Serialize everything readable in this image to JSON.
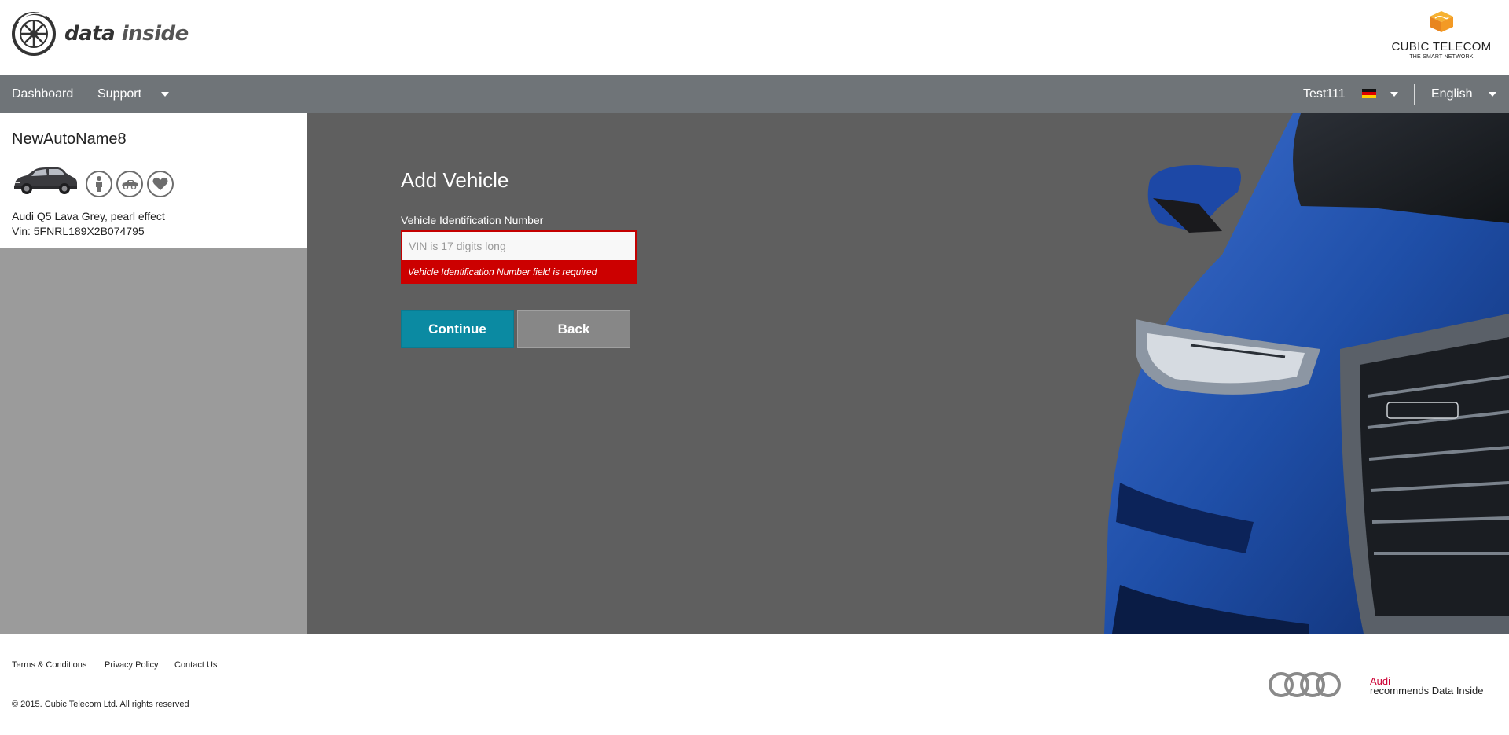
{
  "header": {
    "brand_bold": "data",
    "brand_light": "inside",
    "partner_name": "CUBIC TELECOM",
    "partner_tagline": "THE SMART NETWORK"
  },
  "nav": {
    "items": [
      {
        "label": "Dashboard"
      },
      {
        "label": "Support"
      }
    ],
    "user": "Test111",
    "language": "English"
  },
  "vehicle": {
    "name": "NewAutoName8",
    "model": "Audi Q5 Lava Grey, pearl effect",
    "vin": "Vin: 5FNRL189X2B074795",
    "action_icons": [
      "person-icon",
      "car-icon",
      "heart-icon"
    ]
  },
  "form": {
    "title": "Add Vehicle",
    "vin_label": "Vehicle Identification Number",
    "vin_value": "",
    "vin_placeholder": "VIN is 17 digits long",
    "error": "Vehicle Identification Number field is required",
    "continue_label": "Continue",
    "back_label": "Back"
  },
  "footer": {
    "links": [
      {
        "label": "Terms & Conditions"
      },
      {
        "label": "Privacy Policy"
      },
      {
        "label": "Contact Us"
      }
    ],
    "copyright": "© 2015. Cubic Telecom Ltd. All rights reserved",
    "audi_brand": "Audi",
    "audi_tagline": "recommends Data Inside"
  },
  "colors": {
    "nav_bg": "#6f7478",
    "main_bg": "#5f5f5f",
    "sidebar_bg": "#9b9b9b",
    "accent": "#0b8aa2",
    "error": "#cc0000",
    "audi_red": "#cc0033",
    "car_blue": "#1f4fa8"
  }
}
